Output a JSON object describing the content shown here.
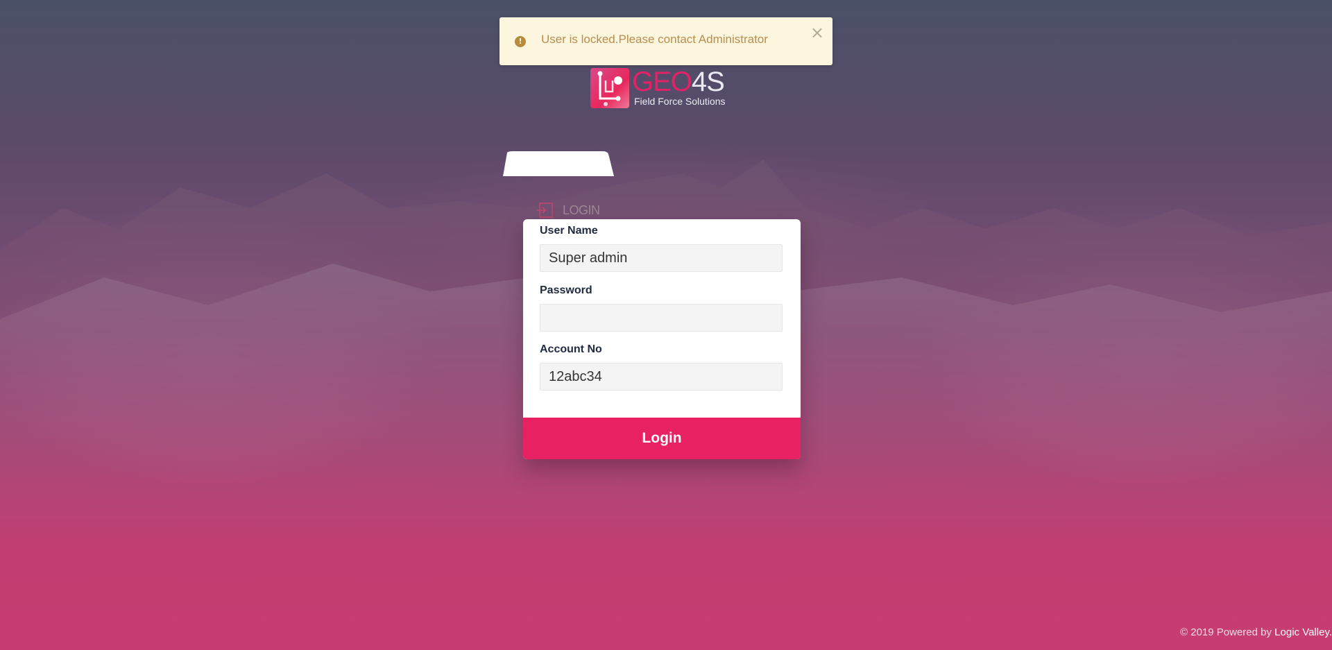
{
  "alert": {
    "message": "User is locked.Please contact Administrator",
    "icon": "exclamation-circle-icon",
    "close_label": "×"
  },
  "logo": {
    "brand_main": "GEO",
    "brand_accent": "4S",
    "tagline": "Field Force Solutions"
  },
  "tab": {
    "label": "LOGIN",
    "icon": "sign-in-icon"
  },
  "form": {
    "username_label": "User Name",
    "username_value": "Super admin",
    "password_label": "Password",
    "password_value": "",
    "account_label": "Account No",
    "account_value": "12abc34",
    "submit_label": "Login"
  },
  "footer": {
    "text": "© 2019 Powered by ",
    "link": "Logic Valley."
  },
  "colors": {
    "accent": "#e82262",
    "alert_bg": "#fdf6df",
    "alert_text": "#b98d4d"
  }
}
